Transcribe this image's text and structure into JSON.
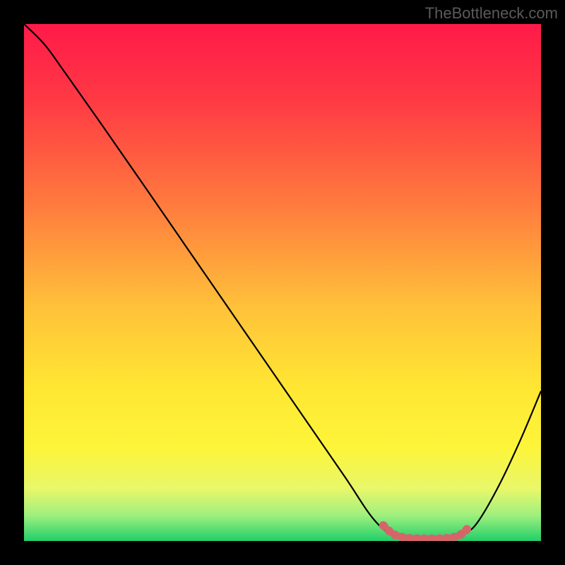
{
  "watermark": "TheBottleneck.com",
  "chart_data": {
    "type": "line",
    "title": "",
    "xlabel": "",
    "ylabel": "",
    "xlim": [
      0,
      100
    ],
    "ylim": [
      0,
      100
    ],
    "gradient_stops": [
      {
        "offset": 0.0,
        "color": "#ff1a49"
      },
      {
        "offset": 0.15,
        "color": "#ff3a44"
      },
      {
        "offset": 0.35,
        "color": "#ff7b3e"
      },
      {
        "offset": 0.55,
        "color": "#ffc23a"
      },
      {
        "offset": 0.7,
        "color": "#ffe633"
      },
      {
        "offset": 0.82,
        "color": "#fdf53a"
      },
      {
        "offset": 0.9,
        "color": "#e8f76a"
      },
      {
        "offset": 0.95,
        "color": "#9ff07e"
      },
      {
        "offset": 1.0,
        "color": "#22cf6a"
      }
    ],
    "series": [
      {
        "name": "curve",
        "color": "#000000",
        "stroke_width": 2.2,
        "points": [
          {
            "x": 0.0,
            "y": 100.0
          },
          {
            "x": 4.0,
            "y": 96.0
          },
          {
            "x": 8.0,
            "y": 90.5
          },
          {
            "x": 14.0,
            "y": 82.0
          },
          {
            "x": 22.0,
            "y": 70.5
          },
          {
            "x": 32.0,
            "y": 56.0
          },
          {
            "x": 42.0,
            "y": 41.5
          },
          {
            "x": 52.0,
            "y": 27.0
          },
          {
            "x": 62.0,
            "y": 12.5
          },
          {
            "x": 67.0,
            "y": 5.0
          },
          {
            "x": 70.5,
            "y": 1.5
          },
          {
            "x": 73.0,
            "y": 0.5
          },
          {
            "x": 78.0,
            "y": 0.4
          },
          {
            "x": 83.0,
            "y": 0.5
          },
          {
            "x": 85.5,
            "y": 1.5
          },
          {
            "x": 88.0,
            "y": 4.0
          },
          {
            "x": 92.0,
            "y": 11.0
          },
          {
            "x": 96.0,
            "y": 19.5
          },
          {
            "x": 100.0,
            "y": 29.0
          }
        ]
      },
      {
        "name": "highlight-band",
        "color": "#d6656a",
        "stroke_width": 12,
        "dash": "1.5 9",
        "points": [
          {
            "x": 69.5,
            "y": 3.0
          },
          {
            "x": 71.5,
            "y": 1.3
          },
          {
            "x": 74.0,
            "y": 0.6
          },
          {
            "x": 77.0,
            "y": 0.45
          },
          {
            "x": 80.0,
            "y": 0.45
          },
          {
            "x": 83.0,
            "y": 0.7
          },
          {
            "x": 85.0,
            "y": 1.6
          },
          {
            "x": 86.2,
            "y": 3.0
          }
        ]
      }
    ]
  }
}
